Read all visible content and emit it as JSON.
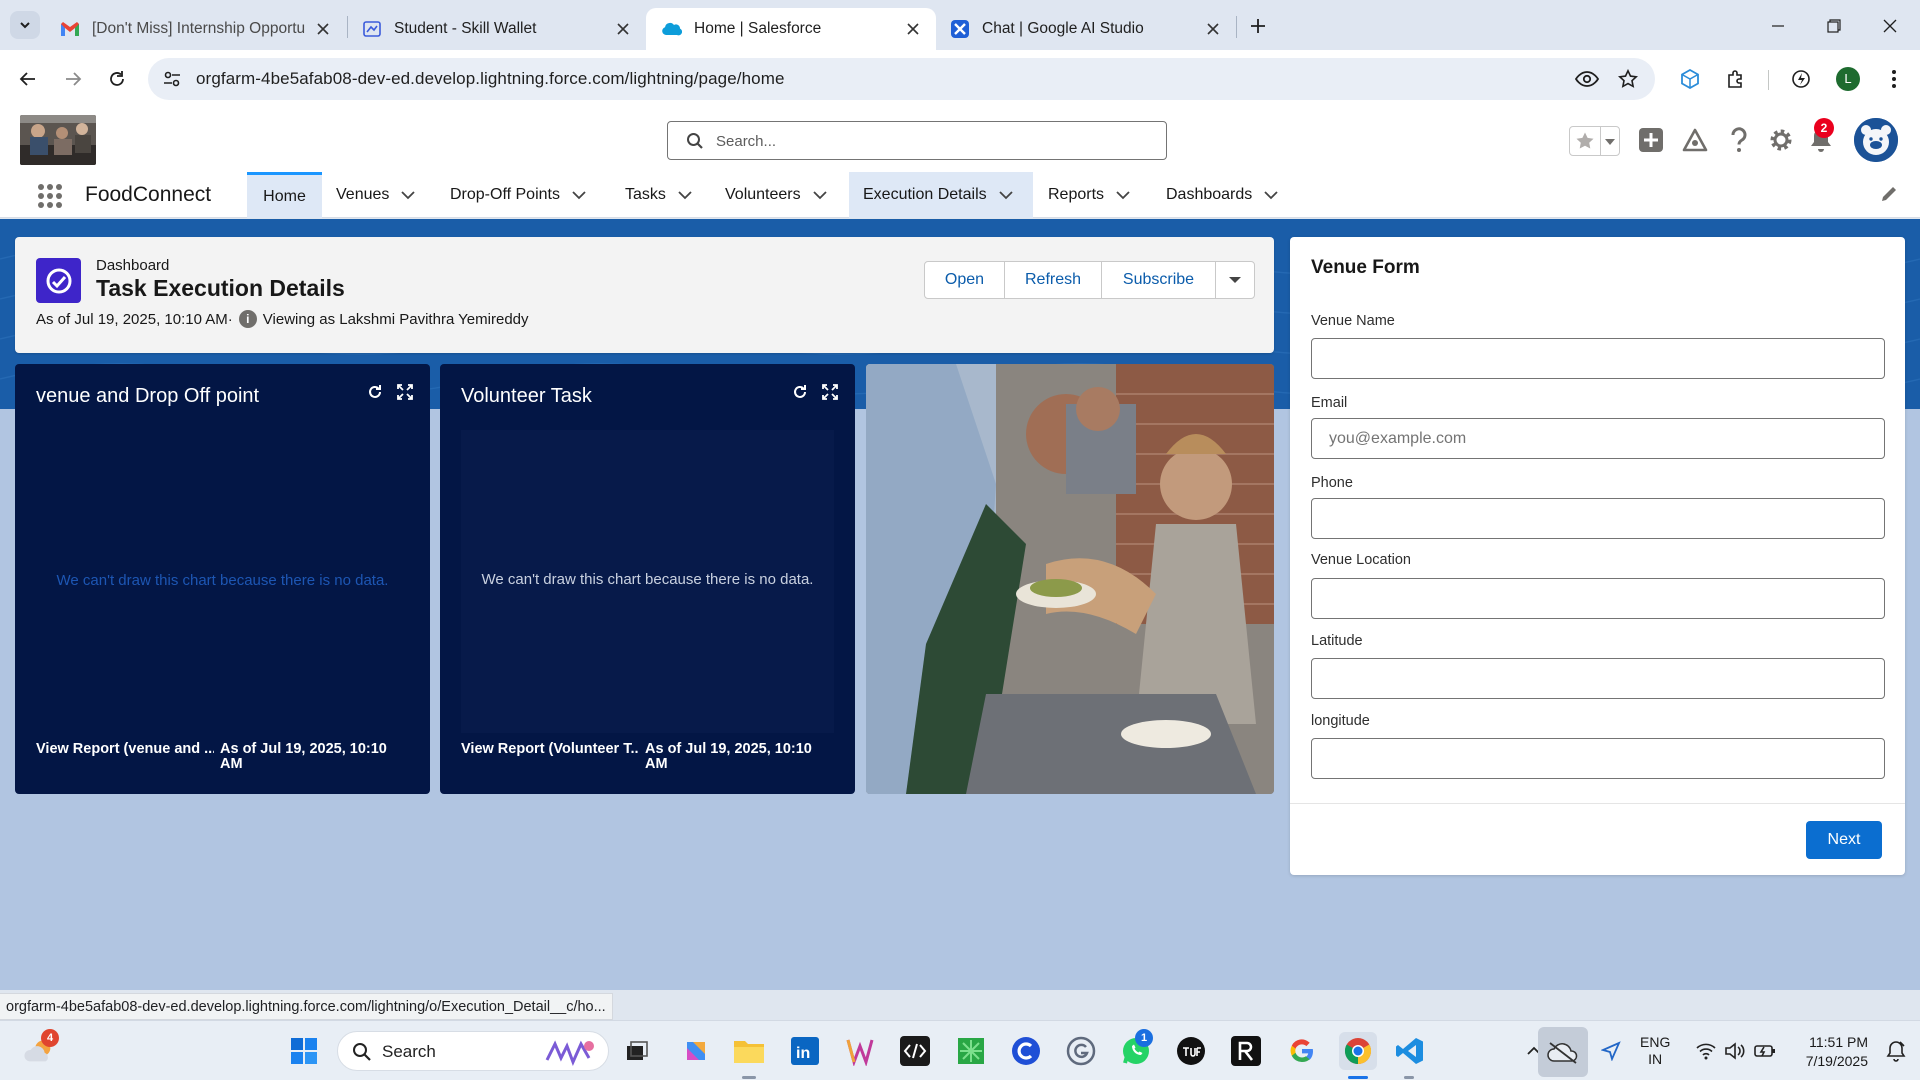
{
  "browser": {
    "tabs": [
      {
        "title": "[Don't Miss] Internship Opportu",
        "icon": "gmail-icon"
      },
      {
        "title": "Student - Skill Wallet",
        "icon": "skill-wallet-icon"
      },
      {
        "title": "Home | Salesforce",
        "icon": "salesforce-cloud-icon",
        "active": true
      },
      {
        "title": "Chat | Google AI Studio",
        "icon": "ai-studio-icon"
      }
    ],
    "url": "orgfarm-4be5afab08-dev-ed.develop.lightning.force.com/lightning/page/home",
    "profile_initial": "L",
    "status_url": "orgfarm-4be5afab08-dev-ed.develop.lightning.force.com/lightning/o/Execution_Detail__c/ho..."
  },
  "sf": {
    "search_placeholder": "Search...",
    "notification_count": "2",
    "app_name": "FoodConnect",
    "nav": [
      {
        "label": "Home"
      },
      {
        "label": "Venues"
      },
      {
        "label": "Drop-Off Points"
      },
      {
        "label": "Tasks"
      },
      {
        "label": "Volunteers"
      },
      {
        "label": "Execution Details"
      },
      {
        "label": "Reports"
      },
      {
        "label": "Dashboards"
      }
    ]
  },
  "dashboard": {
    "kind": "Dashboard",
    "title": "Task Execution Details",
    "as_of": "As of Jul 19, 2025, 10:10 AM·",
    "viewing_as": "Viewing as Lakshmi Pavithra Yemireddy",
    "buttons": {
      "open": "Open",
      "refresh": "Refresh",
      "subscribe": "Subscribe"
    }
  },
  "widgets": [
    {
      "title": "venue and Drop Off point",
      "no_data": "We can't draw this chart because there is no data.",
      "footer": "View Report (venue and ...",
      "as_of": "As of Jul 19, 2025, 10:10 AM"
    },
    {
      "title": "Volunteer Task",
      "no_data": "We can't draw this chart because there is no data.",
      "footer": "View Report (Volunteer T...",
      "as_of": "As of Jul 19, 2025, 10:10 AM"
    }
  ],
  "venue_form": {
    "title": "Venue Form",
    "fields": [
      {
        "label": "Venue Name",
        "value": "",
        "placeholder": ""
      },
      {
        "label": "Email",
        "value": "",
        "placeholder": "you@example.com"
      },
      {
        "label": "Phone",
        "value": "",
        "placeholder": ""
      },
      {
        "label": "Venue Location",
        "value": "",
        "placeholder": ""
      },
      {
        "label": "Latitude",
        "value": "",
        "placeholder": ""
      },
      {
        "label": "longitude",
        "value": "",
        "placeholder": ""
      }
    ],
    "next_label": "Next"
  },
  "taskbar": {
    "weather_badge": "4",
    "search_label": "Search",
    "whatsapp_badge": "1",
    "lang_line1": "ENG",
    "lang_line2": "IN",
    "time": "11:51 PM",
    "date": "7/19/2025"
  },
  "colors": {
    "salesforce_blue": "#0176d3",
    "brand_band": "#1a5da8",
    "widget_bg": "#031645",
    "dashboard_icon": "#3e25c9",
    "next_button": "#0b6ed0",
    "notification_badge": "#ea001e"
  }
}
